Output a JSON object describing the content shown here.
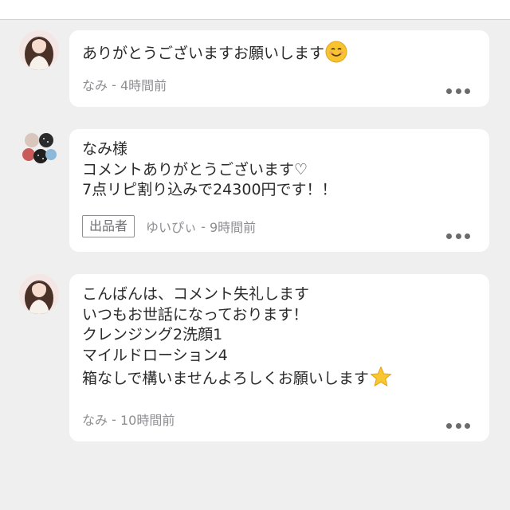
{
  "comments": [
    {
      "lines": [
        "ありがとうございますお願いします"
      ],
      "emoji": "smiling-face-icon",
      "author": "なみ",
      "separator": " - ",
      "time": "4時間前",
      "seller_badge": null
    },
    {
      "lines": [
        "なみ様",
        "コメントありがとうございます♡",
        "7点リピ割り込みで24300円です！！"
      ],
      "author": "ゆいぴぃ",
      "separator": " - ",
      "time": "9時間前",
      "seller_badge": "出品者"
    },
    {
      "lines": [
        "こんばんは、コメント失礼します",
        "いつもお世話になっております！",
        "クレンジング2洗顔1",
        "マイルドローション4",
        "箱なしで構いませんよろしくお願いします"
      ],
      "emoji": "star-icon",
      "author": "なみ",
      "separator": " - ",
      "time": "10時間前",
      "seller_badge": null
    }
  ],
  "colors": {
    "background": "#efeff0",
    "bubble": "#ffffff",
    "meta_text": "#8e8e93",
    "body_text": "#2a2a2a"
  }
}
